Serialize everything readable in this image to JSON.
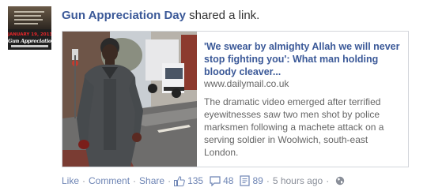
{
  "post": {
    "author": "Gun Appreciation Day",
    "action_text": " shared a link.",
    "avatar": {
      "date_text": "JANUARY 19, 2013",
      "title_text": "Gun Appreciation Day"
    },
    "link": {
      "title": "'We swear by almighty Allah we will never stop fighting you': What man holding bloody cleaver...",
      "domain": "www.dailymail.co.uk",
      "description": "The dramatic video emerged after terrified eyewitnesses saw two men shot by police marksmen following a machete attack on a serving soldier in Woolwich, south-east London."
    },
    "actions": {
      "like": "Like",
      "comment": "Comment",
      "share": "Share",
      "separator": "·"
    },
    "stats": {
      "likes": "135",
      "comments": "48",
      "shares": "89",
      "timestamp": "5 hours ago"
    },
    "icons": {
      "like": "thumbs-up-icon",
      "comment": "comment-bubble-icon",
      "share": "share-icon",
      "privacy": "globe-icon"
    },
    "colors": {
      "link_blue": "#3b5998",
      "action_blue": "#6d84b4",
      "muted_text": "#666666"
    }
  }
}
